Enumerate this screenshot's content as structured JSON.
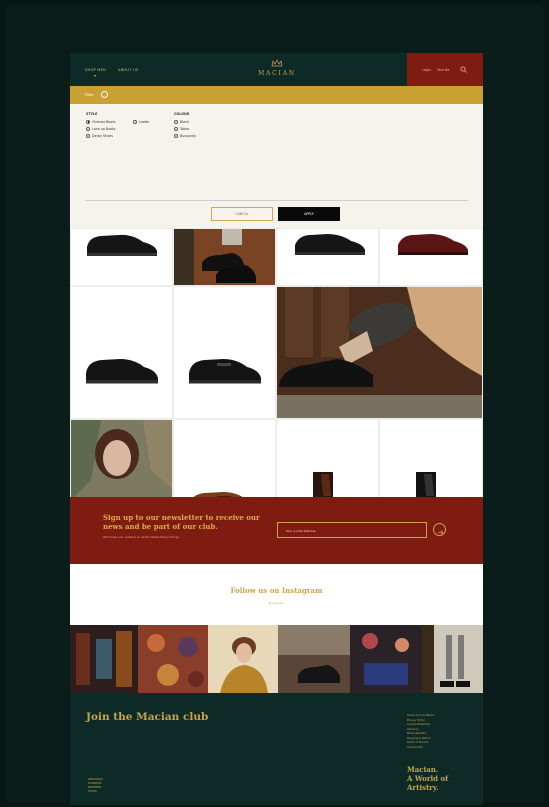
{
  "header": {
    "nav": [
      {
        "label": "SHOP MEN"
      },
      {
        "label": "ABOUT US"
      }
    ],
    "brand": "MACIAN",
    "login_label": "Login",
    "cart_label": "Your Ba"
  },
  "filter": {
    "label": "Filter",
    "style_title": "STYLE",
    "style_options": [
      "Chelsea Boots",
      "Lace-up Boots",
      "Derby Shoes",
      "Loafer"
    ],
    "colour_title": "COLOUR",
    "colour_options": [
      "Black",
      "Tobac",
      "Burgundy"
    ],
    "cancel_label": "CANCEL",
    "apply_label": "APPLY"
  },
  "newsletter": {
    "title": "Sign up to our newsletter to receive our news and be part of our club.",
    "subtitle": "We'll keep you updated on all the latest Macian things.",
    "placeholder": "Your e-mail address"
  },
  "instagram": {
    "title": "Follow us on Instagram",
    "handle": "@_macian_"
  },
  "footer": {
    "club_title": "Join the Macian club",
    "links": [
      "Terms and conditions",
      "Privacy Policy",
      "Cookie Statement",
      "About us",
      "Personalization",
      "Shipping & Return",
      "Terms of Service",
      "Contact Info"
    ],
    "social": [
      "INSTAGRAM",
      "FACEBOOK",
      "PINTEREST",
      "TIKTOK"
    ],
    "tagline_line1": "Macian.",
    "tagline_line2": "A World of",
    "tagline_line3": "Artistry."
  },
  "colors": {
    "dark_green": "#0e2a27",
    "gold": "#c9a032",
    "burgundy": "#7e1c12",
    "cream": "#f5f3ec"
  }
}
